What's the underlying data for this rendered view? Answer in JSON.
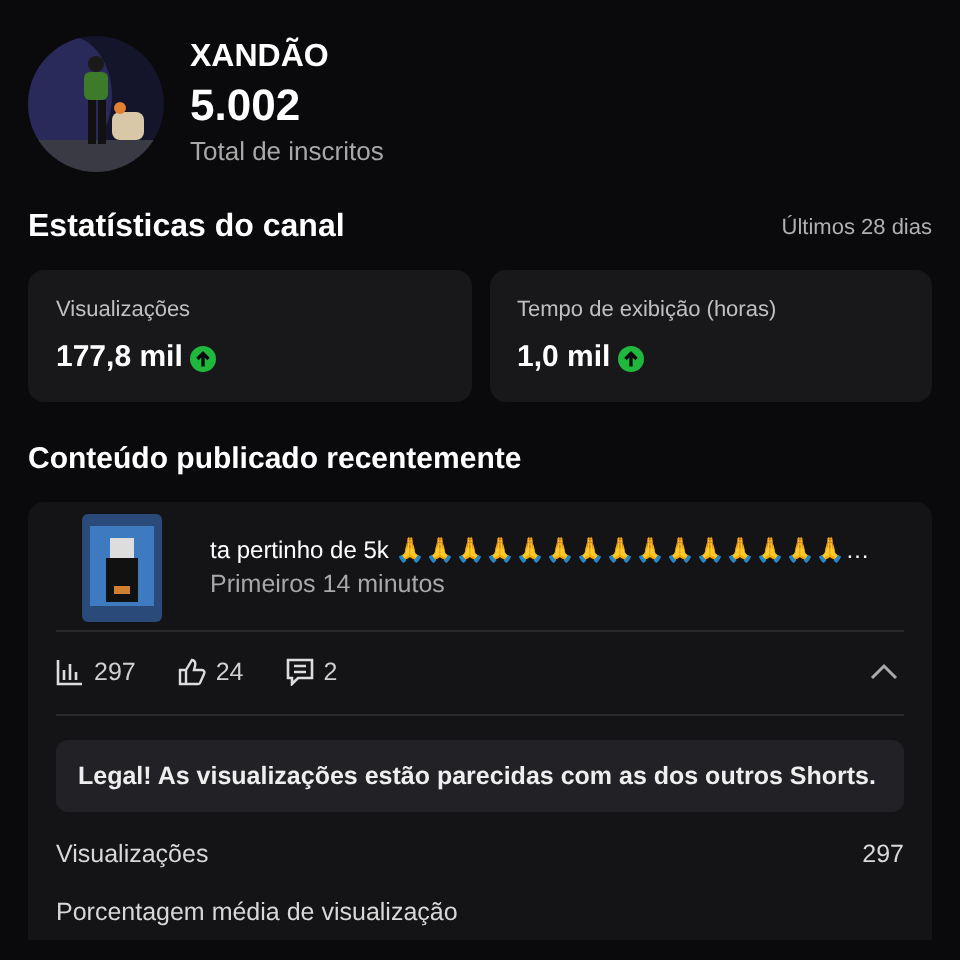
{
  "channel": {
    "name": "XANDÃO",
    "subscribers": "5.002",
    "subscribers_label": "Total de inscritos"
  },
  "stats": {
    "title": "Estatísticas do canal",
    "period": "Últimos 28 dias",
    "cards": [
      {
        "label": "Visualizações",
        "value": "177,8 mil",
        "rising": true
      },
      {
        "label": "Tempo de exibição (horas)",
        "value": "1,0 mil",
        "rising": true
      }
    ]
  },
  "recent": {
    "title": "Conteúdo publicado recentemente",
    "video": {
      "title": "ta pertinho de 5k 🙏🙏🙏🙏🙏🙏🙏🙏🙏🙏🙏🙏🙏🙏🙏…",
      "subtitle": "Primeiros 14 minutos",
      "views": "297",
      "likes": "24",
      "comments": "2",
      "expanded": true
    },
    "insight": "Legal! As visualizações estão parecidas com as dos outros Shorts.",
    "metrics": [
      {
        "label": "Visualizações",
        "value": "297"
      },
      {
        "label": "Porcentagem média de visualização"
      }
    ]
  }
}
